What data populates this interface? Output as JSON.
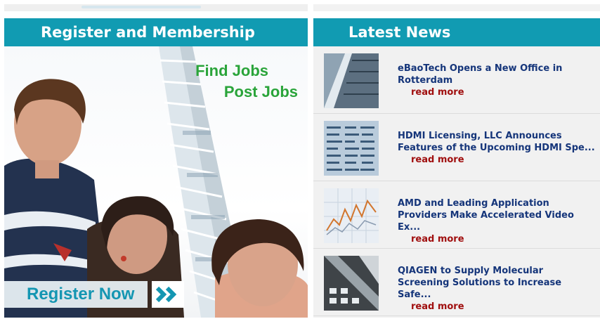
{
  "register": {
    "header": "Register and Membership",
    "tagline_1": "Find Jobs",
    "tagline_2": "Post Jobs",
    "button_label": "Register Now",
    "arrow_icon": "double-chevron-right-icon"
  },
  "news": {
    "header": "Latest News",
    "read_more_label": "read more",
    "items": [
      {
        "title": "eBaoTech Opens a New Office in Rotterdam",
        "thumb": "skyscraper-photo"
      },
      {
        "title": "HDMI Licensing, LLC Announces Features of the Upcoming HDMI Spe...",
        "thumb": "stock-table-photo"
      },
      {
        "title": "AMD and Leading Application Providers Make Accelerated Video Ex...",
        "thumb": "line-chart-photo"
      },
      {
        "title": "QIAGEN to Supply Molecular Screening Solutions to Increase Safe...",
        "thumb": "building-photo"
      }
    ]
  },
  "colors": {
    "header_bg": "#119bb2",
    "accent_green": "#2aa43a",
    "news_title": "#15357a",
    "read_more": "#a00f0f"
  }
}
